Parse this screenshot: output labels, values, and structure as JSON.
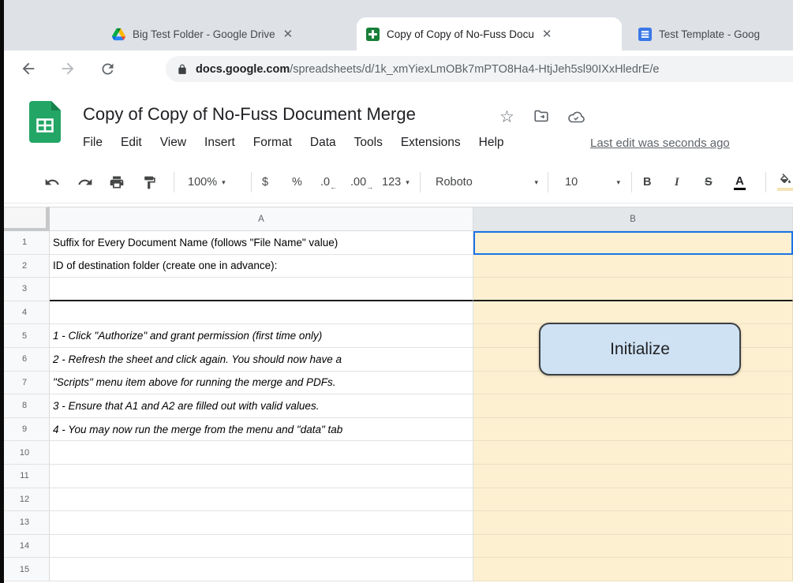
{
  "browser": {
    "tabs": [
      {
        "title": "Big Test Folder - Google Drive"
      },
      {
        "title": "Copy of Copy of No-Fuss Docu"
      },
      {
        "title": "Test Template - Goog"
      }
    ],
    "close_glyph": "✕",
    "url_domain": "docs.google.com",
    "url_path": "/spreadsheets/d/1k_xmYiexLmOBk7mPTO8Ha4-HtjJeh5sl90IXxHledrE/e"
  },
  "header": {
    "title": "Copy of Copy of No-Fuss Document Merge",
    "star_glyph": "☆",
    "menus": [
      "File",
      "Edit",
      "View",
      "Insert",
      "Format",
      "Data",
      "Tools",
      "Extensions",
      "Help"
    ],
    "last_edit": "Last edit was seconds ago"
  },
  "toolbar": {
    "zoom": "100%",
    "currency": "$",
    "percent": "%",
    "decrease_decimal": ".0",
    "increase_decimal": ".00",
    "more_formats": "123",
    "font": "Roboto",
    "font_size": "10",
    "bold": "B",
    "italic": "I",
    "strikethrough": "S",
    "text_color": "A",
    "caret": "▾"
  },
  "sheet": {
    "columns": [
      "A",
      "B"
    ],
    "button_label": "Initialize",
    "colors": {
      "column_b_fill": "#fdf0d0",
      "selection_border": "#1a73e8",
      "button_bg": "#cfe2f3",
      "button_border": "#3b4043"
    },
    "rows": [
      {
        "n": "1",
        "a": "Suffix for Every Document Name (follows \"File Name\" value)"
      },
      {
        "n": "2",
        "a": "ID of destination folder (create one in advance):"
      },
      {
        "n": "3",
        "a": ""
      },
      {
        "n": "4",
        "a": ""
      },
      {
        "n": "5",
        "a": "1 - Click \"Authorize\" and grant permission (first time only)"
      },
      {
        "n": "6",
        "a": "2 - Refresh the sheet and click again. You should now have a"
      },
      {
        "n": "7",
        "a": "\"Scripts\" menu item above for running the merge and PDFs."
      },
      {
        "n": "8",
        "a": "3 - Ensure that A1 and A2 are filled out with valid values."
      },
      {
        "n": "9",
        "a": "4 - You may now run the merge from the menu and \"data\" tab"
      },
      {
        "n": "10",
        "a": ""
      },
      {
        "n": "11",
        "a": ""
      },
      {
        "n": "12",
        "a": ""
      },
      {
        "n": "13",
        "a": ""
      },
      {
        "n": "14",
        "a": ""
      },
      {
        "n": "15",
        "a": ""
      }
    ]
  }
}
